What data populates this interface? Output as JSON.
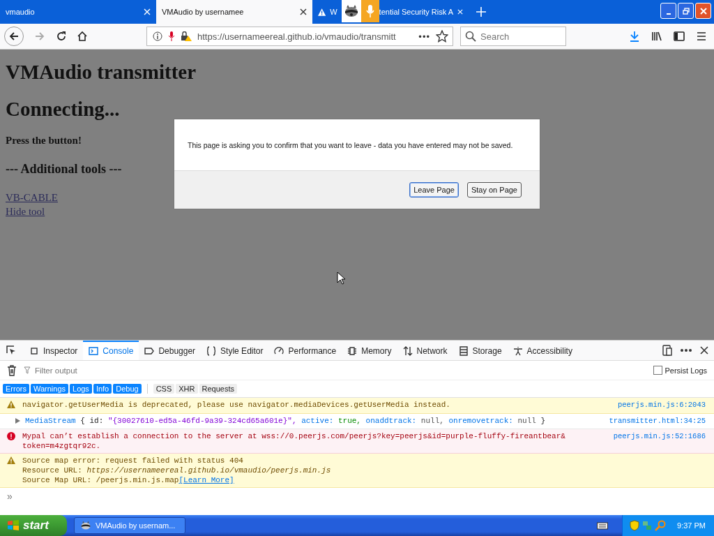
{
  "browser": {
    "tabs": [
      {
        "title": "vmaudio",
        "selected": false,
        "kind": "plain"
      },
      {
        "title": "VMAudio by usernamee",
        "selected": true,
        "kind": "plain"
      },
      {
        "title": "W",
        "title_after": "tential Security Risk A",
        "selected": false,
        "kind": "warning"
      }
    ],
    "address": {
      "url": "https://usernameereal.github.io/vmaudio/transmitt",
      "more": "•••"
    },
    "search": {
      "placeholder": "Search"
    }
  },
  "page": {
    "title": "VMAudio transmitter",
    "status": "Connecting...",
    "prompt": "Press the button!",
    "section": "--- Additional tools ---",
    "links": [
      "VB-CABLE",
      "Hide tool"
    ]
  },
  "dialog": {
    "message": "This page is asking you to confirm that you want to leave - data you have entered may not be saved.",
    "buttons": [
      {
        "label": "Leave Page",
        "selected": true
      },
      {
        "label": "Stay on Page",
        "selected": false
      }
    ]
  },
  "devtools": {
    "tabs": [
      {
        "label": "Inspector",
        "selected": false
      },
      {
        "label": "Console",
        "selected": true
      },
      {
        "label": "Debugger",
        "selected": false
      },
      {
        "label": "Style Editor",
        "selected": false
      },
      {
        "label": "Performance",
        "selected": false
      },
      {
        "label": "Memory",
        "selected": false
      },
      {
        "label": "Network",
        "selected": false
      },
      {
        "label": "Storage",
        "selected": false
      },
      {
        "label": "Accessibility",
        "selected": false
      }
    ],
    "filter": {
      "placeholder": "Filter output"
    },
    "persist": {
      "label": "Persist Logs",
      "checked": false
    },
    "levels": [
      {
        "label": "Errors",
        "selected": true
      },
      {
        "label": "Warnings",
        "selected": true
      },
      {
        "label": "Logs",
        "selected": true
      },
      {
        "label": "Info",
        "selected": true
      },
      {
        "label": "Debug",
        "selected": true
      }
    ],
    "types": [
      {
        "label": "CSS",
        "selected": false
      },
      {
        "label": "XHR",
        "selected": false
      },
      {
        "label": "Requests",
        "selected": false
      }
    ],
    "messages": [
      {
        "kind": "warning",
        "lines": [
          "navigator.getUserMedia is deprecated, please use navigator.mediaDevices.getUserMedia instead."
        ],
        "source": "peerjs.min.js:6:2043"
      },
      {
        "kind": "log",
        "parts": [
          {
            "text": "MediaStream",
            "kind": "object"
          },
          {
            "text": "{",
            "kind": "plain"
          },
          {
            "text": "id:",
            "kind": "plain"
          },
          {
            "text": "\"{30027610-ed5a-46fd-9a39-324cd65a601e}\",",
            "kind": "string"
          },
          {
            "text": "active:",
            "kind": "key"
          },
          {
            "text": "true,",
            "kind": "value"
          },
          {
            "text": "onaddtrack:",
            "kind": "key"
          },
          {
            "text": "null,",
            "kind": "null"
          },
          {
            "text": "onremovetrack:",
            "kind": "key"
          },
          {
            "text": "null",
            "kind": "null"
          },
          {
            "text": "}",
            "kind": "plain"
          }
        ],
        "source": "transmitter.html:34:25"
      },
      {
        "kind": "error",
        "lines": [
          "Mypal can’t establish a connection to the server at wss://0.peerjs.com/peerjs?key=peerjs&id=purple-fluffy-fireantbear&",
          "token=m4zgtqr92c."
        ],
        "source": "peerjs.min.js:52:1686"
      },
      {
        "kind": "warning",
        "lines": [
          "Source map error: request failed with status 404",
          "Resource URL: *https://usernameereal.github.io/vmaudio/peerjs.min.js*",
          "Source Map URL: /peerjs.min.js.map"
        ],
        "link": "[Learn More]"
      }
    ],
    "prompt": "»"
  },
  "taskbar": {
    "start": "start",
    "tasks": [
      {
        "label": "VMAudio by usernam...",
        "selected": false
      }
    ],
    "clock": "9:37 PM"
  }
}
